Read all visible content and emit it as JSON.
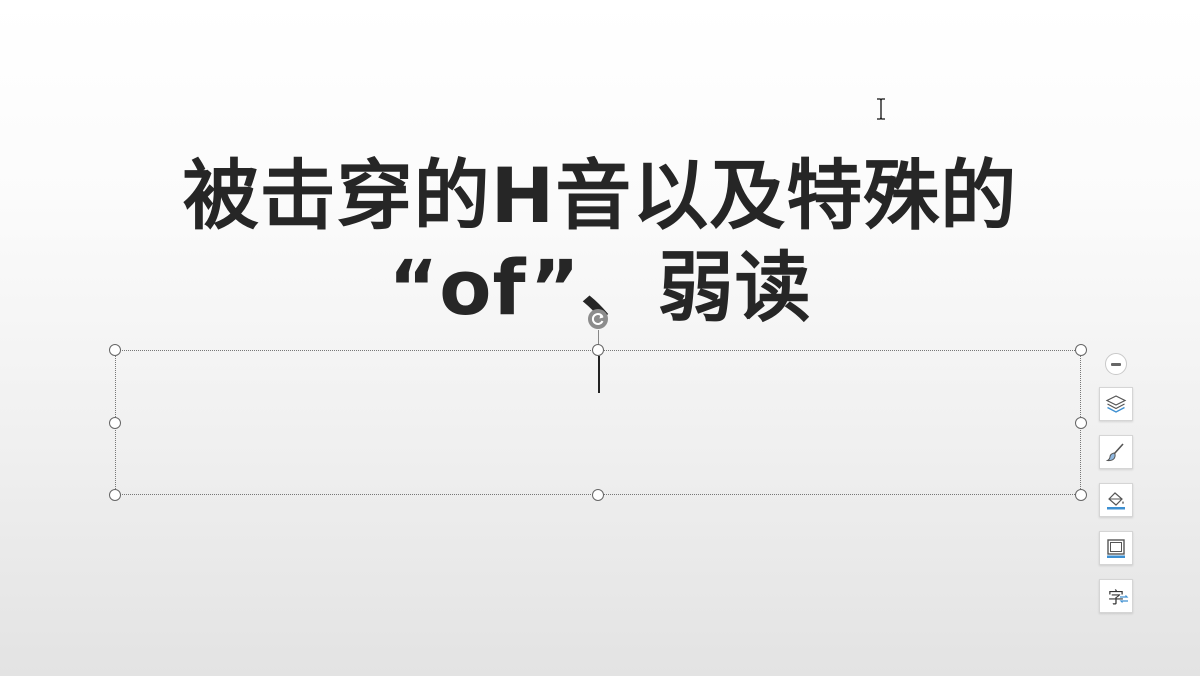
{
  "slide": {
    "title_line1": "被击穿的H音以及特殊的",
    "title_line2": "“of”、弱读"
  },
  "float_toolbar": {
    "items": [
      {
        "icon": "layers-icon"
      },
      {
        "icon": "brush-icon"
      },
      {
        "icon": "fill-bucket-icon"
      },
      {
        "icon": "border-frame-icon"
      },
      {
        "icon": "text-direction-icon",
        "label": "字"
      }
    ]
  },
  "colors": {
    "title": "#262626",
    "accent_blue": "#3d8fd1"
  }
}
